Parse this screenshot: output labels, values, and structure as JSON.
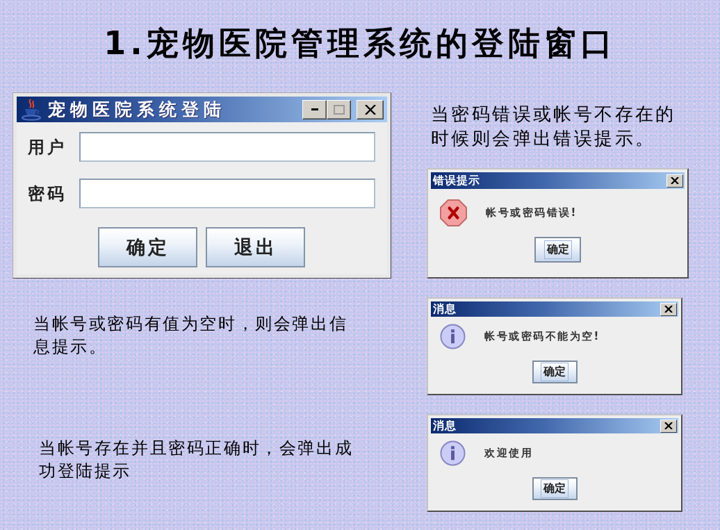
{
  "title": "1.宠物医院管理系统的登陆窗口",
  "login_window": {
    "title": "宠物医院系统登陆",
    "window_controls": [
      {
        "kind": "minimize",
        "disabled": false
      },
      {
        "kind": "maximize",
        "disabled": true
      },
      {
        "kind": "close",
        "disabled": false
      }
    ],
    "fields": [
      {
        "label": "用户"
      },
      {
        "label": "密码"
      }
    ],
    "buttons": [
      {
        "label": "确定"
      },
      {
        "label": "退出"
      }
    ]
  },
  "captions": [
    "当密码错误或帐号不存在的时候则会弹出错误提示。",
    "当帐号或密码有值为空时，则会弹出信息提示。",
    "当帐号存在并且密码正确时，会弹出成功登陆提示"
  ],
  "dialogs": [
    {
      "title": "错误提示",
      "kind": "error",
      "message": "帐号或密码错误!",
      "button": {
        "label": "确定",
        "focused": true
      }
    },
    {
      "title": "消息",
      "kind": "info",
      "message": "帐号或密码不能为空!",
      "button": {
        "label": "确定",
        "focused": true
      }
    },
    {
      "title": "消息",
      "kind": "info",
      "message": "欢迎使用",
      "button": {
        "label": "确定",
        "focused": true
      }
    }
  ]
}
